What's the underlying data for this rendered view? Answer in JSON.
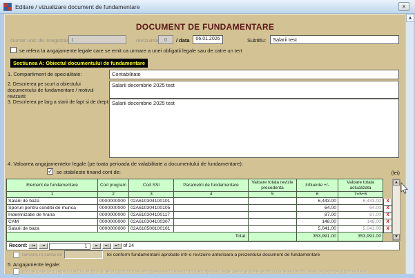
{
  "window": {
    "title": "Editare / vizualizare document de fundamentare"
  },
  "icons": {
    "close": "×",
    "check": "✓",
    "scroll_up": "▲",
    "scroll_down": "▼",
    "nav_first": "|◄",
    "nav_prev": "◄",
    "nav_next": "►",
    "nav_last": "►|",
    "nav_new": "►*",
    "delete": "X"
  },
  "colors": {
    "client_bg": "#d3c293",
    "title_text": "#5a1616",
    "section_header_bg": "#000000",
    "section_header_text": "#ffff00",
    "table_header_bg": "#ccffcc",
    "delete_x": "#cc0000"
  },
  "header": {
    "title": "DOCUMENT DE FUNDAMENTARE"
  },
  "meta": {
    "reg_label": "Numar unic de inregistrare:",
    "reg_value": "1",
    "rev_label": "revizuirea",
    "rev_value": "0",
    "date_label": "/ data",
    "date_value": "06.01.2026",
    "subtitle_label": "Subtitlu:",
    "subtitle_value": "Salarii test"
  },
  "tert_checkbox": {
    "label": "se refera la angajamente legale care se emit ca urmare a unei obligatii legale sau de catre un tert",
    "checked": false
  },
  "section_a": {
    "title": "Sectiunea A: Obiectul documentului de fundamentare"
  },
  "fields": {
    "f1_label": "1. Compartiment de specialitate:",
    "f1_value": "Contabilitate",
    "f2_label": "2. Descrierea pe scurt a obiectului documentului de fundamentare / motivul revizuirii:",
    "f2_value": "Salarii decembrie 2025 test",
    "f3_label": "3. Descrierea pe larg a starii de fapt si de drept:",
    "f3_value": "Salarii decembrie 2025 test"
  },
  "section4": {
    "label": "4. Valoarea angajamentelor legale (pe toata perioada de valabilitate a documentului de fundamentare):",
    "checkbox_label": "se stabileste tinand cont de:",
    "checked": true,
    "unit_label": "(lei)"
  },
  "table": {
    "headers": [
      "Element de fundamentare",
      "Cod program",
      "Cod SSI",
      "Parametrii de fundamentare",
      "Valoare totala revizie precedenta",
      "Influente +/-",
      "Valoare totala actualizata"
    ],
    "col_numbers": [
      "1",
      "2",
      "3",
      "4",
      "5",
      "6",
      "7=5+6"
    ],
    "rows": [
      {
        "element": "Salarii de baza",
        "cod_program": "0000000000",
        "cod_ssi": "02A610304100101",
        "parametrii": "",
        "val_precedenta": "",
        "influente": "6,443.00",
        "val_actualizata": "6,443.00"
      },
      {
        "element": "Sporuri pentru conditii de munca",
        "cod_program": "0000000000",
        "cod_ssi": "02A610304100105",
        "parametrii": "",
        "val_precedenta": "",
        "influente": "64.00",
        "val_actualizata": "64.00"
      },
      {
        "element": "Indemnizatie de hrana",
        "cod_program": "0000000000",
        "cod_ssi": "02A610304100117",
        "parametrii": "",
        "val_precedenta": "",
        "influente": "87.00",
        "val_actualizata": "87.00"
      },
      {
        "element": "CAM",
        "cod_program": "0000000000",
        "cod_ssi": "02A610304100307",
        "parametrii": "",
        "val_precedenta": "",
        "influente": "148.00",
        "val_actualizata": "148.00"
      },
      {
        "element": "Salarii de baza",
        "cod_program": "0000000000",
        "cod_ssi": "02A610500100101",
        "parametrii": "",
        "val_precedenta": "",
        "influente": "5,041.00",
        "val_actualizata": "5,041.00"
      }
    ],
    "total": {
      "label": "Total:",
      "influente": "353,991.00",
      "val_actualizata": "353,991.00"
    }
  },
  "record_nav": {
    "label": "Record:",
    "current": "1",
    "count_label": "of 24"
  },
  "ramane": {
    "label": "ramane in suma de",
    "value": "",
    "suffix": "lei conform fundamentarii aprobate intr-o revizuire anterioara a prezentului document de fundamentare"
  },
  "section5": {
    "label": "5. Angajamente legale:"
  },
  "legal_checkbox": {
    "label": "noul angajament legal nu a fost emis si in anul curent nu se anticipeaza emiterea noului angajament legal pana la finele anului / pana la identificarea de resurse suplimentare",
    "checked": false
  }
}
